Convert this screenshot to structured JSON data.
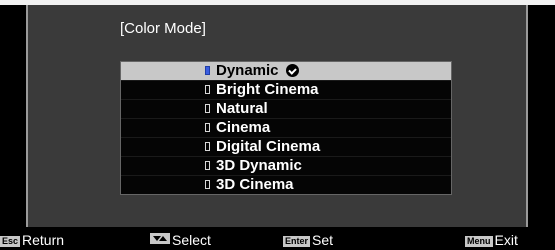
{
  "panel": {
    "title": "[Color Mode]"
  },
  "menu": {
    "items": [
      {
        "label": "Dynamic",
        "selected": true
      },
      {
        "label": "Bright Cinema",
        "selected": false
      },
      {
        "label": "Natural",
        "selected": false
      },
      {
        "label": "Cinema",
        "selected": false
      },
      {
        "label": "Digital Cinema",
        "selected": false
      },
      {
        "label": "3D Dynamic",
        "selected": false
      },
      {
        "label": "3D Cinema",
        "selected": false
      }
    ]
  },
  "footer": {
    "return_key": "Esc",
    "return_label": "Return",
    "select_label": "Select",
    "set_key": "Enter",
    "set_label": "Set",
    "exit_key": "Menu",
    "exit_label": "Exit"
  },
  "colors": {
    "selected_radio": "#3a5de0",
    "highlight": "#c8c8c8"
  }
}
